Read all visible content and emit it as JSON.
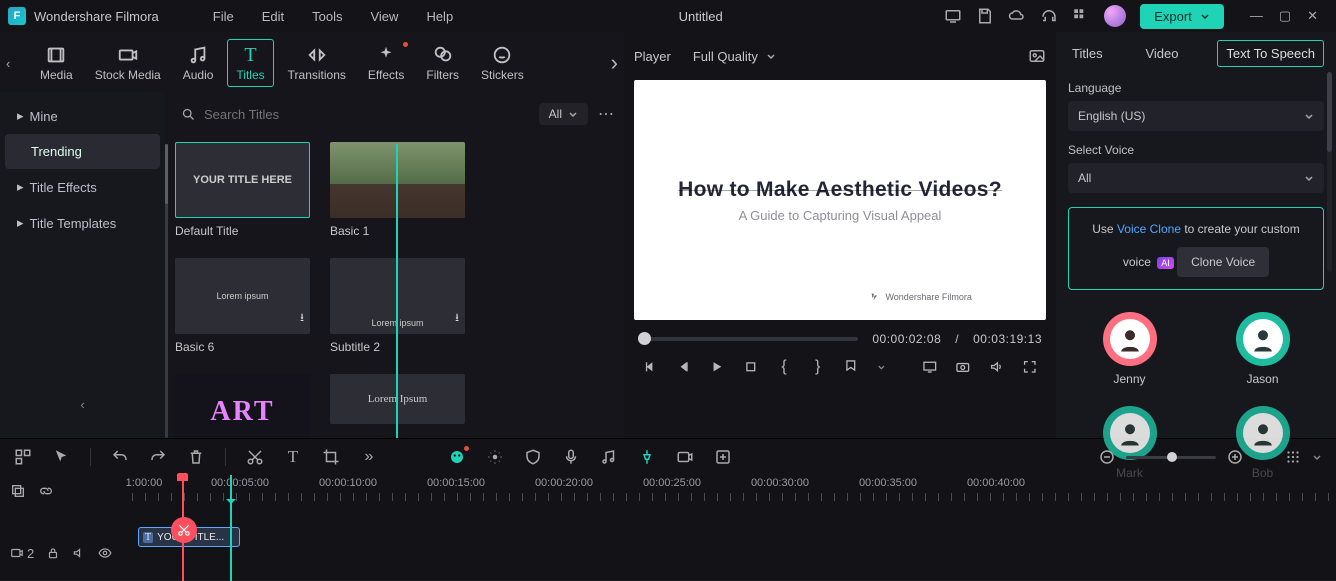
{
  "app": {
    "name": "Wondershare Filmora",
    "document": "Untitled"
  },
  "menu": [
    "File",
    "Edit",
    "Tools",
    "View",
    "Help"
  ],
  "export": {
    "label": "Export"
  },
  "leftTabs": [
    {
      "label": "Media",
      "icon": "film"
    },
    {
      "label": "Stock Media",
      "icon": "camera"
    },
    {
      "label": "Audio",
      "icon": "music"
    },
    {
      "label": "Titles",
      "icon": "T",
      "active": true
    },
    {
      "label": "Transitions",
      "icon": "bowtie"
    },
    {
      "label": "Effects",
      "icon": "sparkle",
      "dot": true
    },
    {
      "label": "Filters",
      "icon": "sliders"
    },
    {
      "label": "Stickers",
      "icon": "smile"
    }
  ],
  "sidebar": {
    "items": [
      {
        "label": "Mine",
        "expand": true
      },
      {
        "label": "Trending",
        "active": true
      },
      {
        "label": "Title Effects",
        "expand": true
      },
      {
        "label": "Title Templates",
        "expand": true
      }
    ]
  },
  "search": {
    "placeholder": "Search Titles",
    "filter": "All"
  },
  "cards": [
    {
      "name": "Default Title",
      "thumb_text": "YOUR TITLE HERE",
      "active": true
    },
    {
      "name": "Basic 1",
      "thumb": "photo"
    },
    {
      "name": "Basic 6",
      "thumb_text": "Lorem ipsum",
      "dl": true
    },
    {
      "name": "Subtitle 2",
      "thumb_text": "Lorem ipsum",
      "dl": true
    },
    {
      "name": "",
      "thumb": "art",
      "thumb_text": "ART"
    },
    {
      "name": "",
      "thumb_text": "Lorem Ipsum",
      "partial": true
    }
  ],
  "player": {
    "label": "Player",
    "quality": "Full Quality",
    "title": "How to Make Aesthetic Videos?",
    "subtitle": "A Guide to Capturing Visual Appeal",
    "brand": "Wondershare Filmora",
    "current": "00:00:02:08",
    "sep": "/",
    "duration": "00:03:19:13"
  },
  "right": {
    "tabs": [
      {
        "label": "Titles"
      },
      {
        "label": "Video"
      },
      {
        "label": "Text To Speech",
        "active": true
      }
    ],
    "language_label": "Language",
    "language_value": "English (US)",
    "voice_label": "Select Voice",
    "voice_value": "All",
    "clone_pre": "Use ",
    "clone_link": "Voice Clone",
    "clone_post": " to create your custom voice",
    "clone_btn": "Clone Voice",
    "voices": [
      {
        "name": "Jenny",
        "female": true
      },
      {
        "name": "Jason"
      },
      {
        "name": "Mark"
      },
      {
        "name": "Bob"
      }
    ]
  },
  "timeline": {
    "marks": [
      "1:00:00",
      "00:00:05:00",
      "00:00:10:00",
      "00:00:15:00",
      "00:00:20:00",
      "00:00:25:00",
      "00:00:30:00",
      "00:00:35:00",
      "00:00:40:00"
    ],
    "clip_label": "YOUR TITLE...",
    "track_count": "2"
  }
}
